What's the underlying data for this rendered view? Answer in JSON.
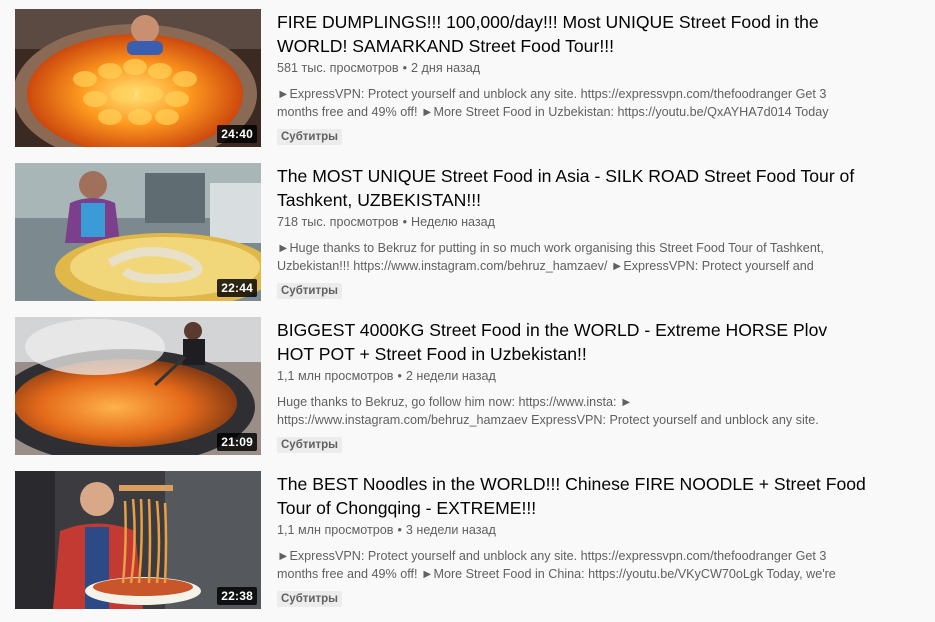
{
  "videos": [
    {
      "title": "FIRE DUMPLINGS!!! 100,000/day!!! Most UNIQUE Street Food in the WORLD! SAMARKAND Street Food Tour!!!",
      "views": "581 тыс. просмотров",
      "separator": "•",
      "age": "2 дня назад",
      "description": "►ExpressVPN: Protect yourself and unblock any site. https://expressvpn.com/thefoodranger Get 3 months free and 49% off! ►More Street Food in Uzbekistan: https://youtu.be/QxAYHA7d014 Today",
      "duration": "24:40",
      "badge": "Субтитры",
      "thumbnail_icon": "tandoor-oven-thumbnail"
    },
    {
      "title": "The MOST UNIQUE Street Food in Asia - SILK ROAD Street Food Tour of Tashkent, UZBEKISTAN!!!",
      "views": "718 тыс. просмотров",
      "separator": "•",
      "age": "Неделю назад",
      "description": "►Huge thanks to Bekruz for putting in so much work organising this Street Food Tour of Tashkent, Uzbekistan!!! https://www.instagram.com/behruz_hamzaev/ ►ExpressVPN: Protect yourself and",
      "duration": "22:44",
      "badge": "Субтитры",
      "thumbnail_icon": "market-vendor-thumbnail"
    },
    {
      "title": "BIGGEST 4000KG Street Food in the WORLD - Extreme HORSE Plov HOT POT + Street Food in Uzbekistan!!",
      "views": "1,1 млн просмотров",
      "separator": "•",
      "age": "2 недели назад",
      "description": "Huge thanks to Bekruz, go follow him now: https://www.insta: ► https://www.instagram.com/behruz_hamzaev ExpressVPN: Protect yourself and unblock any site.",
      "duration": "21:09",
      "badge": "Субтитры",
      "thumbnail_icon": "giant-plov-pan-thumbnail"
    },
    {
      "title": "The BEST Noodles in the WORLD!!! Chinese FIRE NOODLE + Street Food Tour of Chongqing - EXTREME!!!",
      "views": "1,1 млн просмотров",
      "separator": "•",
      "age": "3 недели назад",
      "description": "►ExpressVPN: Protect yourself and unblock any site. https://expressvpn.com/thefoodranger Get 3 months free and 49% off! ►More Street Food in China: https://youtu.be/VKyCW70oLgk Today, we're",
      "duration": "22:38",
      "badge": "Субтитры",
      "thumbnail_icon": "noodle-bowl-thumbnail"
    }
  ]
}
